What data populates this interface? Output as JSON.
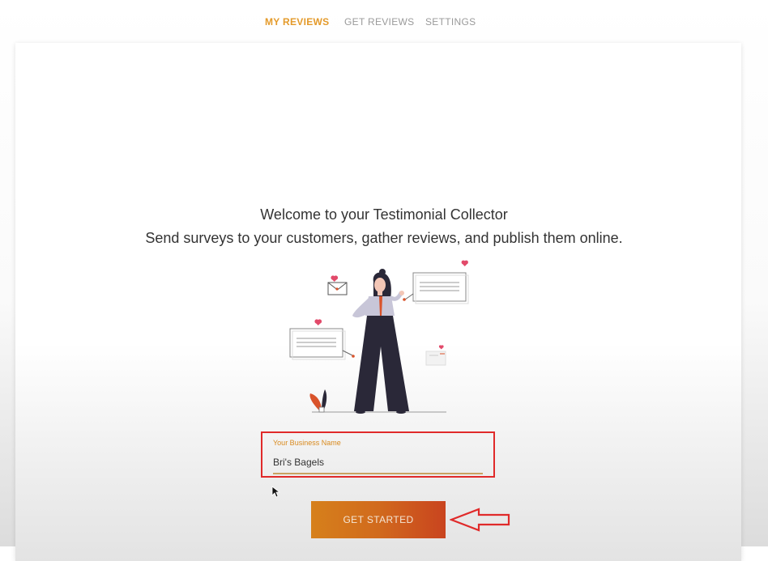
{
  "nav": {
    "tabs": [
      {
        "label": "MY REVIEWS",
        "active": true
      },
      {
        "label": "GET REVIEWS",
        "active": false
      },
      {
        "label": "SETTINGS",
        "active": false
      }
    ]
  },
  "main": {
    "title": "Welcome to your Testimonial Collector",
    "subtitle": "Send surveys to your customers, gather reviews, and publish them online."
  },
  "form": {
    "business_name_label": "Your Business Name",
    "business_name_value": "Bri's Bagels"
  },
  "cta": {
    "label": "GET STARTED"
  },
  "colors": {
    "accent": "#e49a2a",
    "button_start": "#d6801b",
    "button_end": "#c9441f",
    "annotation": "#e02a2a"
  }
}
